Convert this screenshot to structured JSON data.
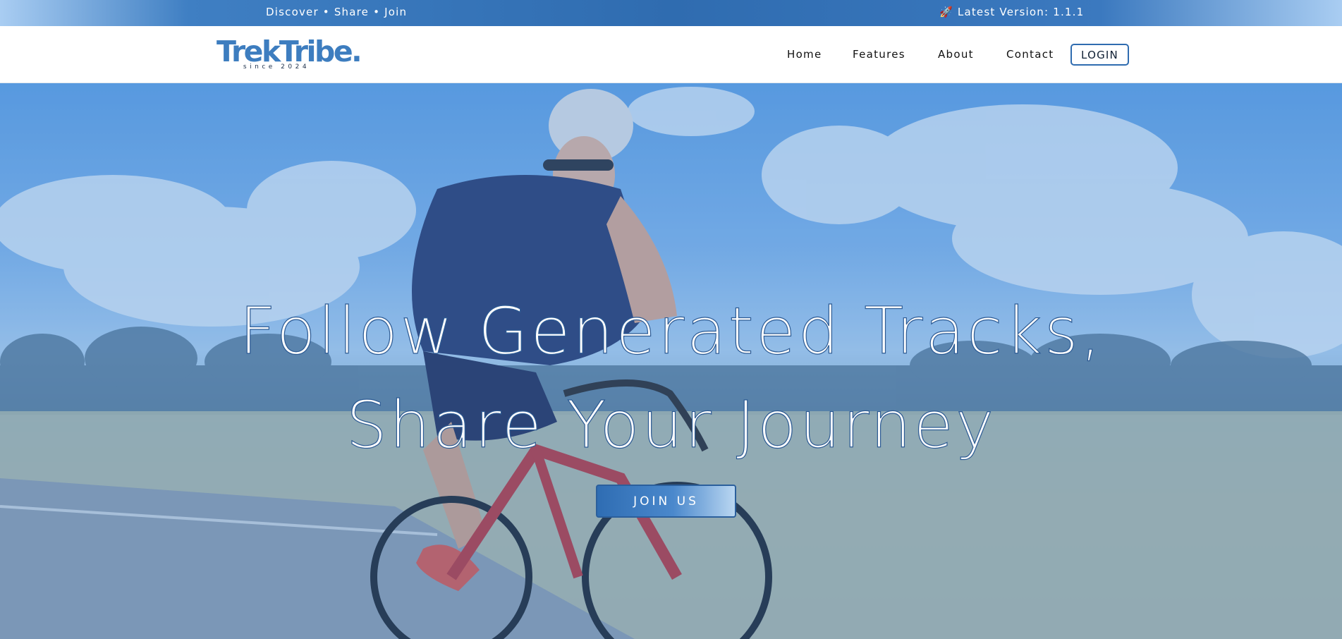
{
  "topbar": {
    "tagline": "Discover • Share • Join",
    "version_icon": "🚀",
    "version_text": "Latest Version: 1.1.1"
  },
  "brand": {
    "name": "TrekTribe.",
    "since": "since 2024",
    "color": "#3d7dbf"
  },
  "nav": {
    "items": [
      {
        "label": "Home"
      },
      {
        "label": "Features"
      },
      {
        "label": "About"
      },
      {
        "label": "Contact"
      }
    ],
    "login_label": "LOGIN"
  },
  "hero": {
    "headline_line1": "Follow Generated Tracks,",
    "headline_line2": "Share Your Journey",
    "cta_label": "JOIN US",
    "background_image": "cyclist-on-road-photo"
  },
  "colors": {
    "accent": "#2f6cb0",
    "topbar_mid": "#2f6cb0",
    "text_dark": "#111111"
  }
}
